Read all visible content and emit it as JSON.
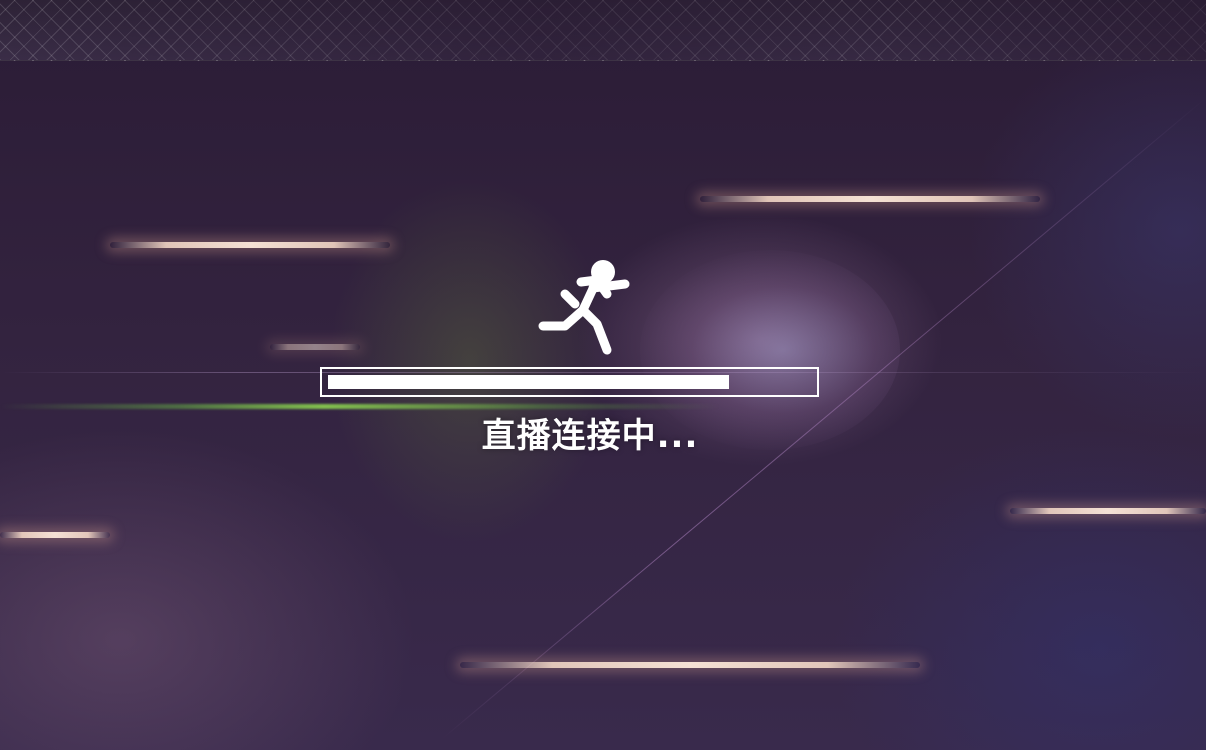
{
  "loading": {
    "status_text": "直播连接中...",
    "progress_fraction": 0.83,
    "icon": "running-man-icon"
  },
  "colors": {
    "background": "#2a1d3d",
    "foreground": "#ffffff",
    "accent_green": "#8cd250"
  }
}
